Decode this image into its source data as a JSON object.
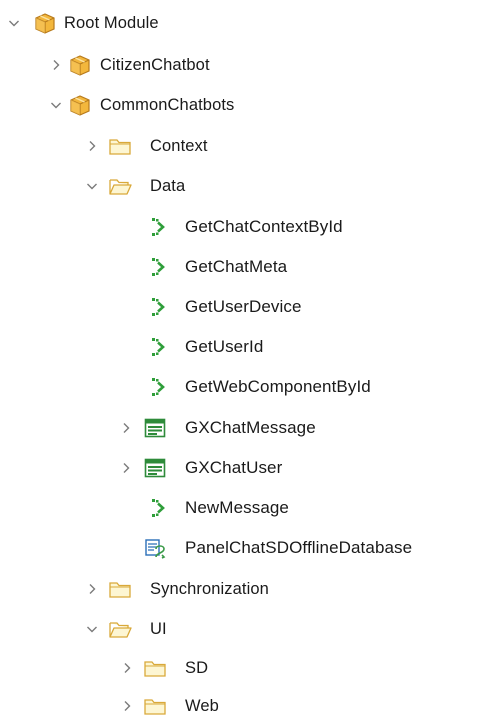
{
  "tree": {
    "root": {
      "label": "Root Module",
      "icon": "module-icon",
      "expanded": true
    },
    "citizen": {
      "label": "CitizenChatbot",
      "icon": "module-icon",
      "expanded": false
    },
    "common": {
      "label": "CommonChatbots",
      "icon": "module-icon",
      "expanded": true
    },
    "context": {
      "label": "Context",
      "icon": "folder-icon",
      "expanded": false
    },
    "data": {
      "label": "Data",
      "icon": "folder-open-icon",
      "expanded": true
    },
    "get_chat_context": {
      "label": "GetChatContextById",
      "icon": "procedure-icon"
    },
    "get_chat_meta": {
      "label": "GetChatMeta",
      "icon": "procedure-icon"
    },
    "get_user_device": {
      "label": "GetUserDevice",
      "icon": "procedure-icon"
    },
    "get_user_id": {
      "label": "GetUserId",
      "icon": "procedure-icon"
    },
    "get_web_component": {
      "label": "GetWebComponentById",
      "icon": "procedure-icon"
    },
    "gx_chat_message": {
      "label": "GXChatMessage",
      "icon": "transaction-icon",
      "expanded": false
    },
    "gx_chat_user": {
      "label": "GXChatUser",
      "icon": "transaction-icon",
      "expanded": false
    },
    "new_message": {
      "label": "NewMessage",
      "icon": "procedure-icon"
    },
    "panel_offline_db": {
      "label": "PanelChatSDOfflineDatabase",
      "icon": "offline-database-icon"
    },
    "synchronization": {
      "label": "Synchronization",
      "icon": "folder-icon",
      "expanded": false
    },
    "ui": {
      "label": "UI",
      "icon": "folder-open-icon",
      "expanded": true
    },
    "sd": {
      "label": "SD",
      "icon": "folder-icon",
      "expanded": false
    },
    "web": {
      "label": "Web",
      "icon": "folder-icon",
      "expanded": false
    }
  },
  "colors": {
    "chevron": "#7a7a7a",
    "folder_fill": "#fdf6d3",
    "folder_stroke": "#d9a93a",
    "module_fill": "#f3b73c",
    "module_stroke": "#b87b1c",
    "procedure_green": "#2f9e3a",
    "transaction_green": "#2e8b3a",
    "offline_blue": "#2b6fb8"
  }
}
